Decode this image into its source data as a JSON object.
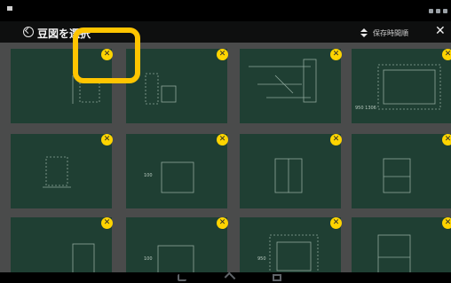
{
  "app": {
    "title": "豆図を選択",
    "sort_label": "保存時間順",
    "sort_icon": "sort-updown-icon",
    "close_icon": "close-icon",
    "back_icon": "back-circle-icon"
  },
  "grid": {
    "delete_icon": "delete-x-icon",
    "tiles": [
      {
        "label": "",
        "row": 0,
        "col": 0
      },
      {
        "label": "",
        "row": 0,
        "col": 1
      },
      {
        "label": "",
        "row": 0,
        "col": 2
      },
      {
        "label": "950 1306",
        "row": 0,
        "col": 3
      },
      {
        "label": "",
        "row": 1,
        "col": 0
      },
      {
        "label": "100",
        "row": 1,
        "col": 1
      },
      {
        "label": "",
        "row": 1,
        "col": 2
      },
      {
        "label": "",
        "row": 1,
        "col": 3
      },
      {
        "label": "",
        "row": 2,
        "col": 0
      },
      {
        "label": "100",
        "row": 2,
        "col": 1
      },
      {
        "label": "950",
        "row": 2,
        "col": 2
      },
      {
        "label": "",
        "row": 2,
        "col": 3
      }
    ]
  },
  "highlight": {
    "color": "#ffc500"
  },
  "colors": {
    "tile_bg": "#1f3f33",
    "grid_bg": "#4a4b4b",
    "delete_badge": "#ffd400",
    "toolbar_bg": "#0e0f0f"
  },
  "navigation": {
    "back_icon": "nav-back-icon",
    "home_icon": "nav-home-icon",
    "recent_icon": "nav-recent-icon"
  }
}
